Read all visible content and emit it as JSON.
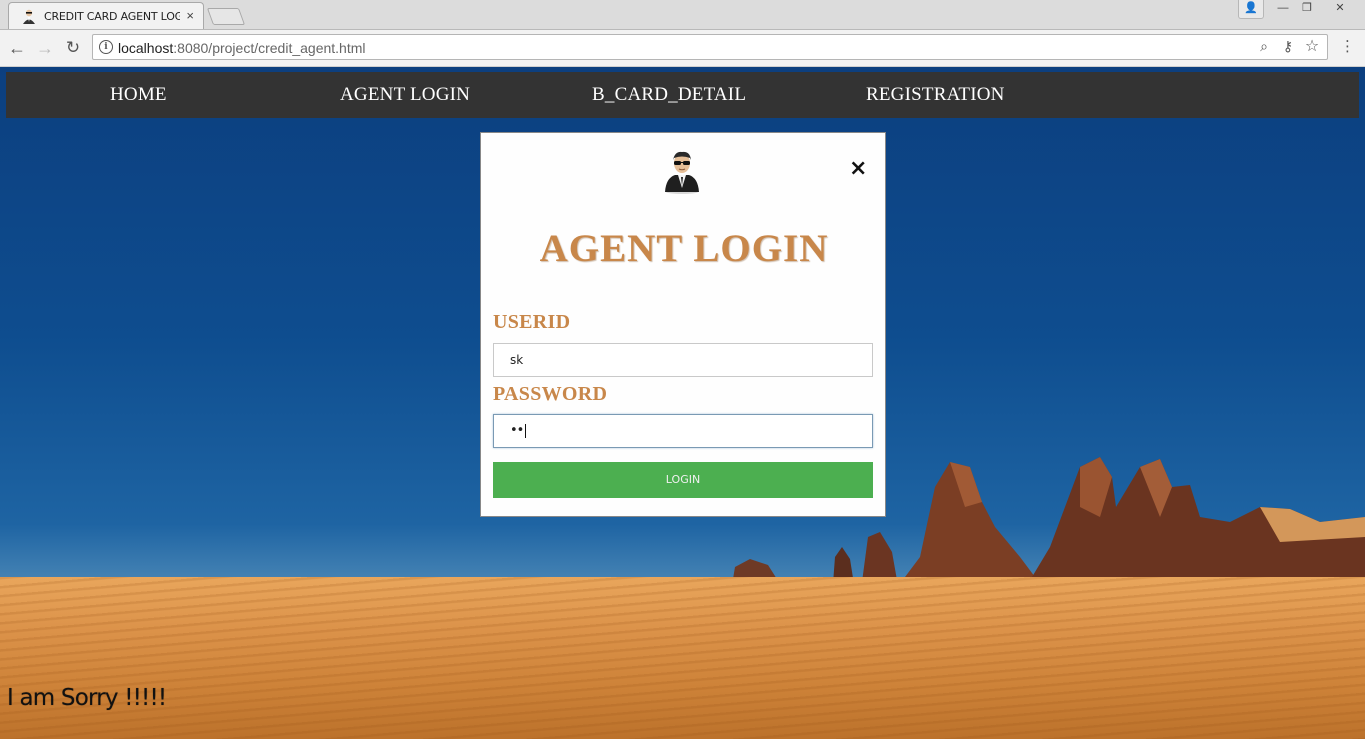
{
  "browser": {
    "tab_title": "CREDIT CARD AGENT LOGI",
    "tab_close": "×",
    "url_host": "localhost",
    "url_rest": ":8080/project/credit_agent.html",
    "window_controls": {
      "user": "👤",
      "minimize": "—",
      "maximize": "❐",
      "close": "✕"
    },
    "nav": {
      "back": "←",
      "forward": "→",
      "reload": "↻"
    },
    "icons": {
      "info": "i",
      "zoom": "⌕",
      "key": "⚷",
      "star": "☆",
      "menu": "⋮"
    }
  },
  "site_nav": {
    "items": [
      {
        "label": "HOME"
      },
      {
        "label": "AGENT LOGIN"
      },
      {
        "label": "B_CARD_DETAIL"
      },
      {
        "label": "REGISTRATION"
      }
    ]
  },
  "modal": {
    "close_label": "×",
    "title": "AGENT LOGIN",
    "userid_label": "USERID",
    "userid_value": "sk",
    "password_label": "PASSWORD",
    "password_value": "••",
    "login_button": "LOGIN"
  },
  "footer_message": "I am Sorry !!!!!",
  "colors": {
    "nav_bg": "#333333",
    "accent_text": "#c8874a",
    "login_button": "#4caf50",
    "sky": "#0e4d8f",
    "sand": "#dc934a"
  }
}
